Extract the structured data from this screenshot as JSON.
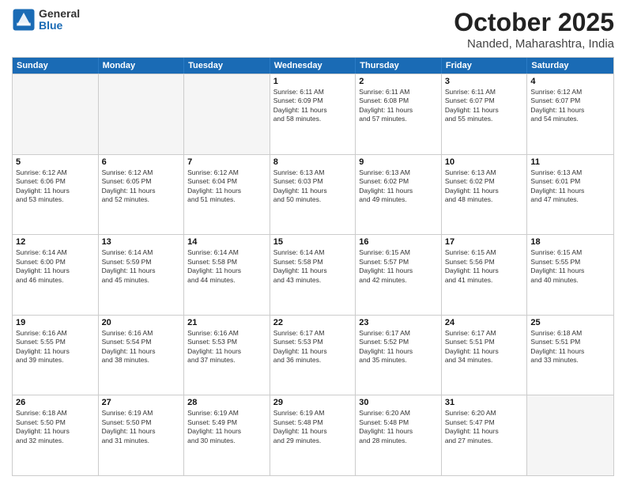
{
  "header": {
    "logo_general": "General",
    "logo_blue": "Blue",
    "title": "October 2025",
    "location": "Nanded, Maharashtra, India"
  },
  "weekdays": [
    "Sunday",
    "Monday",
    "Tuesday",
    "Wednesday",
    "Thursday",
    "Friday",
    "Saturday"
  ],
  "rows": [
    [
      {
        "day": "",
        "info": ""
      },
      {
        "day": "",
        "info": ""
      },
      {
        "day": "",
        "info": ""
      },
      {
        "day": "1",
        "info": "Sunrise: 6:11 AM\nSunset: 6:09 PM\nDaylight: 11 hours\nand 58 minutes."
      },
      {
        "day": "2",
        "info": "Sunrise: 6:11 AM\nSunset: 6:08 PM\nDaylight: 11 hours\nand 57 minutes."
      },
      {
        "day": "3",
        "info": "Sunrise: 6:11 AM\nSunset: 6:07 PM\nDaylight: 11 hours\nand 55 minutes."
      },
      {
        "day": "4",
        "info": "Sunrise: 6:12 AM\nSunset: 6:07 PM\nDaylight: 11 hours\nand 54 minutes."
      }
    ],
    [
      {
        "day": "5",
        "info": "Sunrise: 6:12 AM\nSunset: 6:06 PM\nDaylight: 11 hours\nand 53 minutes."
      },
      {
        "day": "6",
        "info": "Sunrise: 6:12 AM\nSunset: 6:05 PM\nDaylight: 11 hours\nand 52 minutes."
      },
      {
        "day": "7",
        "info": "Sunrise: 6:12 AM\nSunset: 6:04 PM\nDaylight: 11 hours\nand 51 minutes."
      },
      {
        "day": "8",
        "info": "Sunrise: 6:13 AM\nSunset: 6:03 PM\nDaylight: 11 hours\nand 50 minutes."
      },
      {
        "day": "9",
        "info": "Sunrise: 6:13 AM\nSunset: 6:02 PM\nDaylight: 11 hours\nand 49 minutes."
      },
      {
        "day": "10",
        "info": "Sunrise: 6:13 AM\nSunset: 6:02 PM\nDaylight: 11 hours\nand 48 minutes."
      },
      {
        "day": "11",
        "info": "Sunrise: 6:13 AM\nSunset: 6:01 PM\nDaylight: 11 hours\nand 47 minutes."
      }
    ],
    [
      {
        "day": "12",
        "info": "Sunrise: 6:14 AM\nSunset: 6:00 PM\nDaylight: 11 hours\nand 46 minutes."
      },
      {
        "day": "13",
        "info": "Sunrise: 6:14 AM\nSunset: 5:59 PM\nDaylight: 11 hours\nand 45 minutes."
      },
      {
        "day": "14",
        "info": "Sunrise: 6:14 AM\nSunset: 5:58 PM\nDaylight: 11 hours\nand 44 minutes."
      },
      {
        "day": "15",
        "info": "Sunrise: 6:14 AM\nSunset: 5:58 PM\nDaylight: 11 hours\nand 43 minutes."
      },
      {
        "day": "16",
        "info": "Sunrise: 6:15 AM\nSunset: 5:57 PM\nDaylight: 11 hours\nand 42 minutes."
      },
      {
        "day": "17",
        "info": "Sunrise: 6:15 AM\nSunset: 5:56 PM\nDaylight: 11 hours\nand 41 minutes."
      },
      {
        "day": "18",
        "info": "Sunrise: 6:15 AM\nSunset: 5:55 PM\nDaylight: 11 hours\nand 40 minutes."
      }
    ],
    [
      {
        "day": "19",
        "info": "Sunrise: 6:16 AM\nSunset: 5:55 PM\nDaylight: 11 hours\nand 39 minutes."
      },
      {
        "day": "20",
        "info": "Sunrise: 6:16 AM\nSunset: 5:54 PM\nDaylight: 11 hours\nand 38 minutes."
      },
      {
        "day": "21",
        "info": "Sunrise: 6:16 AM\nSunset: 5:53 PM\nDaylight: 11 hours\nand 37 minutes."
      },
      {
        "day": "22",
        "info": "Sunrise: 6:17 AM\nSunset: 5:53 PM\nDaylight: 11 hours\nand 36 minutes."
      },
      {
        "day": "23",
        "info": "Sunrise: 6:17 AM\nSunset: 5:52 PM\nDaylight: 11 hours\nand 35 minutes."
      },
      {
        "day": "24",
        "info": "Sunrise: 6:17 AM\nSunset: 5:51 PM\nDaylight: 11 hours\nand 34 minutes."
      },
      {
        "day": "25",
        "info": "Sunrise: 6:18 AM\nSunset: 5:51 PM\nDaylight: 11 hours\nand 33 minutes."
      }
    ],
    [
      {
        "day": "26",
        "info": "Sunrise: 6:18 AM\nSunset: 5:50 PM\nDaylight: 11 hours\nand 32 minutes."
      },
      {
        "day": "27",
        "info": "Sunrise: 6:19 AM\nSunset: 5:50 PM\nDaylight: 11 hours\nand 31 minutes."
      },
      {
        "day": "28",
        "info": "Sunrise: 6:19 AM\nSunset: 5:49 PM\nDaylight: 11 hours\nand 30 minutes."
      },
      {
        "day": "29",
        "info": "Sunrise: 6:19 AM\nSunset: 5:48 PM\nDaylight: 11 hours\nand 29 minutes."
      },
      {
        "day": "30",
        "info": "Sunrise: 6:20 AM\nSunset: 5:48 PM\nDaylight: 11 hours\nand 28 minutes."
      },
      {
        "day": "31",
        "info": "Sunrise: 6:20 AM\nSunset: 5:47 PM\nDaylight: 11 hours\nand 27 minutes."
      },
      {
        "day": "",
        "info": ""
      }
    ]
  ]
}
